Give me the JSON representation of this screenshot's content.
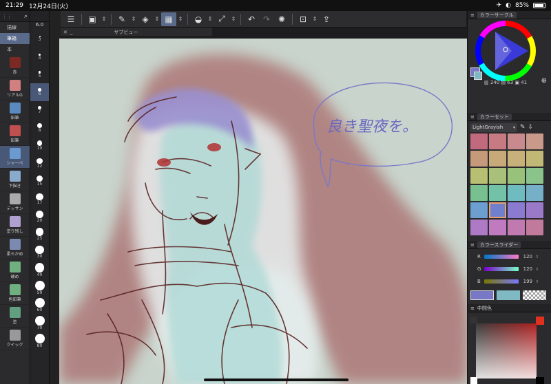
{
  "status": {
    "time": "21:29",
    "date": "12月24日(火)",
    "battery": "85%"
  },
  "sub_tools": [
    {
      "label": "描線",
      "active": false
    },
    {
      "label": "筆箱",
      "active": true
    },
    {
      "label": "本",
      "active": false
    }
  ],
  "tools": [
    {
      "label": "赤",
      "color": "#7a2a22",
      "active": false
    },
    {
      "label": "リアルG",
      "color": "#d08080",
      "active": false
    },
    {
      "label": "鉛筆",
      "color": "#5a8abf",
      "active": false
    },
    {
      "label": "鉛筆",
      "color": "#c05050",
      "active": false
    },
    {
      "label": "シャーペ",
      "color": "#6a9ad0",
      "active": true
    },
    {
      "label": "下描き",
      "color": "#8aaacc",
      "active": false
    },
    {
      "label": "デッサン",
      "color": "#aaa",
      "active": false
    },
    {
      "label": "塗り残し",
      "color": "#b0a0d0",
      "active": false
    },
    {
      "label": "柔らかめ",
      "color": "#7a8ab0",
      "active": false
    },
    {
      "label": "硬め",
      "color": "#70b080",
      "active": false
    },
    {
      "label": "色鉛筆",
      "color": "#70b080",
      "active": false
    },
    {
      "label": "塗",
      "color": "#60a080",
      "active": false
    },
    {
      "label": "クイック",
      "color": "#999",
      "active": false
    }
  ],
  "brush_size_value": "6.0",
  "brush_sizes": [
    "3",
    "4",
    "5",
    "6",
    "7",
    "8",
    "10",
    "12",
    "15",
    "17",
    "20",
    "25",
    "30",
    "40",
    "50",
    "60",
    "70",
    "80"
  ],
  "active_size": "6",
  "subview_title": "サブビュー",
  "canvas_text": "良き聖夜を。",
  "color_circle": {
    "title": "カラーサークル",
    "h": "240",
    "s": "63",
    "v": "41"
  },
  "color_set": {
    "title": "カラーセット",
    "set_name": "LightGrayish",
    "swatches": [
      "#c26a7d",
      "#c87a82",
      "#c88a8c",
      "#c99a8a",
      "#c59a7a",
      "#c8aa7a",
      "#c8b07a",
      "#c0b874",
      "#b8be72",
      "#a8c07a",
      "#98c27a",
      "#8ac48a",
      "#78c090",
      "#72c2a8",
      "#6ebcc0",
      "#76b0c8",
      "#6c9ed0",
      "#7080cc",
      "#8a7ad0",
      "#9a7ac8",
      "#ae7ac6",
      "#c07ac0",
      "#c07ab0",
      "#c27a9c"
    ],
    "selected_index": 17
  },
  "color_slider": {
    "title": "カラースライダー",
    "rows": [
      {
        "label": "R",
        "value": "120"
      },
      {
        "label": "G",
        "value": "120"
      },
      {
        "label": "B",
        "value": "199"
      }
    ]
  },
  "intermediate": {
    "title": "中間色"
  },
  "colors": {
    "main": "#7878c7",
    "sub": "#7fb9c4",
    "accent": "#5a6a8a"
  }
}
